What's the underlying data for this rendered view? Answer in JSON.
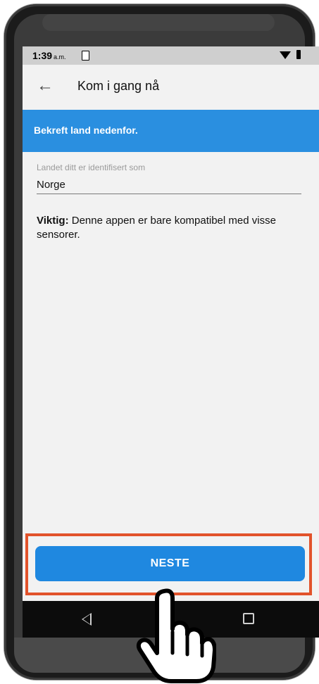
{
  "status_bar": {
    "time": "1:39",
    "ampm": "a.m."
  },
  "app_bar": {
    "title": "Kom i gang nå"
  },
  "banner": {
    "text": "Bekreft land nedenfor."
  },
  "country_field": {
    "label": "Landet ditt er identifisert som",
    "value": "Norge"
  },
  "note": {
    "bold": "Viktig:",
    "text": " Denne appen er bare kompatibel med visse sensorer."
  },
  "actions": {
    "next_label": "NESTE"
  },
  "colors": {
    "accent": "#1f88e0",
    "banner": "#2a8fe0",
    "highlight": "#e2532b"
  },
  "icons": [
    "back-arrow-icon",
    "sim-card-icon",
    "wifi-icon",
    "battery-icon",
    "nav-back-icon",
    "nav-recents-icon",
    "hand-pointer-icon"
  ]
}
